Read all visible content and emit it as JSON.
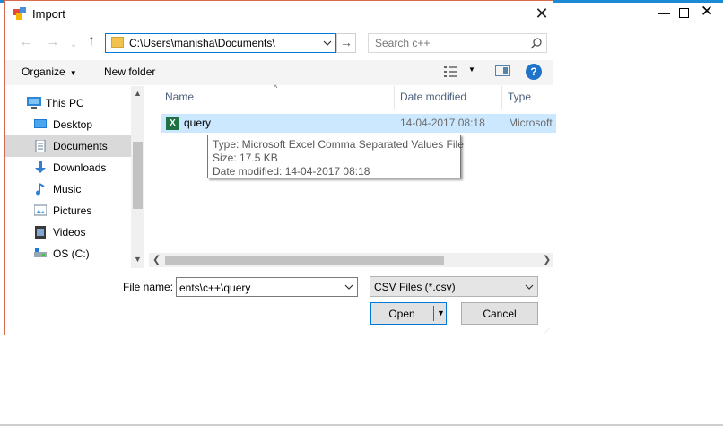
{
  "dialog": {
    "title": "Import",
    "close_glyph": "✕"
  },
  "background_window": {
    "minimize_glyph": "—",
    "close_glyph": "✕"
  },
  "nav": {
    "back_glyph": "←",
    "forward_glyph": "→",
    "up_glyph": "↑",
    "recent_glyph": "⌄",
    "go_glyph": "→",
    "address": "C:\\Users\\manisha\\Documents\\",
    "search_placeholder": "Search c++"
  },
  "toolbar": {
    "organize_label": "Organize",
    "new_folder_label": "New folder",
    "help_label": "?"
  },
  "sidebar": {
    "items": [
      {
        "label": "This PC",
        "icon": "monitor-icon",
        "selected": false
      },
      {
        "label": "Desktop",
        "icon": "desktop-icon",
        "selected": false
      },
      {
        "label": "Documents",
        "icon": "documents-icon",
        "selected": true
      },
      {
        "label": "Downloads",
        "icon": "download-icon",
        "selected": false
      },
      {
        "label": "Music",
        "icon": "music-icon",
        "selected": false
      },
      {
        "label": "Pictures",
        "icon": "pictures-icon",
        "selected": false
      },
      {
        "label": "Videos",
        "icon": "videos-icon",
        "selected": false
      },
      {
        "label": "OS (C:)",
        "icon": "drive-icon",
        "selected": false
      }
    ]
  },
  "file_list": {
    "columns": [
      "Name",
      "Date modified",
      "Type"
    ],
    "rows": [
      {
        "name": "query",
        "date_modified": "14-04-2017 08:18",
        "type": "Microsoft",
        "icon": "excel-icon",
        "icon_text": "X"
      }
    ],
    "tooltip": {
      "type_line": "Type: Microsoft Excel Comma Separated Values File",
      "size_line": "Size: 17.5 KB",
      "date_line": "Date modified: 14-04-2017 08:18"
    }
  },
  "form": {
    "filename_label": "File name:",
    "filename_value": "ents\\c++\\query",
    "filetype_value": "CSV Files (*.csv)",
    "open_label": "Open",
    "cancel_label": "Cancel"
  },
  "colors": {
    "accent": "#0078d7",
    "selection": "#cce8ff",
    "sidebar_selected": "#d9d9d9",
    "dialog_border": "#d86a4e",
    "excel_green": "#1e7145"
  }
}
